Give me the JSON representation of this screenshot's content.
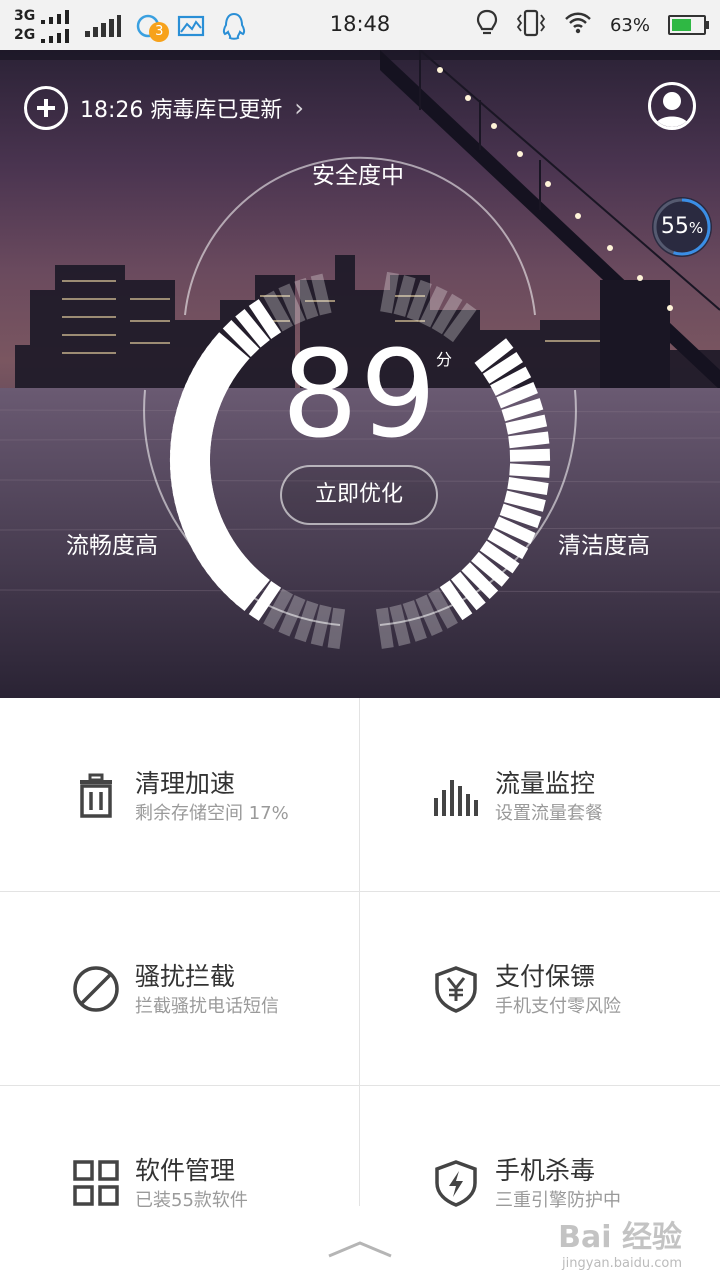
{
  "status_bar": {
    "sim1": "3G",
    "sim2": "2G",
    "notif_badge": "3",
    "time": "18:48",
    "battery": "63%"
  },
  "hero": {
    "update_text": "18:26 病毒库已更新",
    "update_chevron": "›",
    "ring_percent": "55",
    "ring_percent_unit": "%",
    "ring_fraction": 0.55,
    "safety_label": "安全度中",
    "smooth_label": "流畅度高",
    "clean_label": "清洁度高",
    "score": "89",
    "score_unit": "分",
    "optimize_button": "立即优化"
  },
  "features": [
    {
      "title": "清理加速",
      "subtitle": "剩余存储空间 17%",
      "icon": "trash-icon"
    },
    {
      "title": "流量监控",
      "subtitle": "设置流量套餐",
      "icon": "bar-chart-icon"
    },
    {
      "title": "骚扰拦截",
      "subtitle": "拦截骚扰电话短信",
      "icon": "block-icon"
    },
    {
      "title": "支付保镖",
      "subtitle": "手机支付零风险",
      "icon": "yen-shield-icon"
    },
    {
      "title": "软件管理",
      "subtitle": "已装55款软件",
      "icon": "grid-icon"
    },
    {
      "title": "手机杀毒",
      "subtitle": "三重引擎防护中",
      "icon": "lightning-shield-icon"
    }
  ],
  "watermark": {
    "main": "Bai 经验",
    "sub": "jingyan.baidu.com"
  },
  "colors": {
    "battery": "#2fb844",
    "badge": "#f7a21b",
    "ring_progress": "#3a8ee6"
  }
}
